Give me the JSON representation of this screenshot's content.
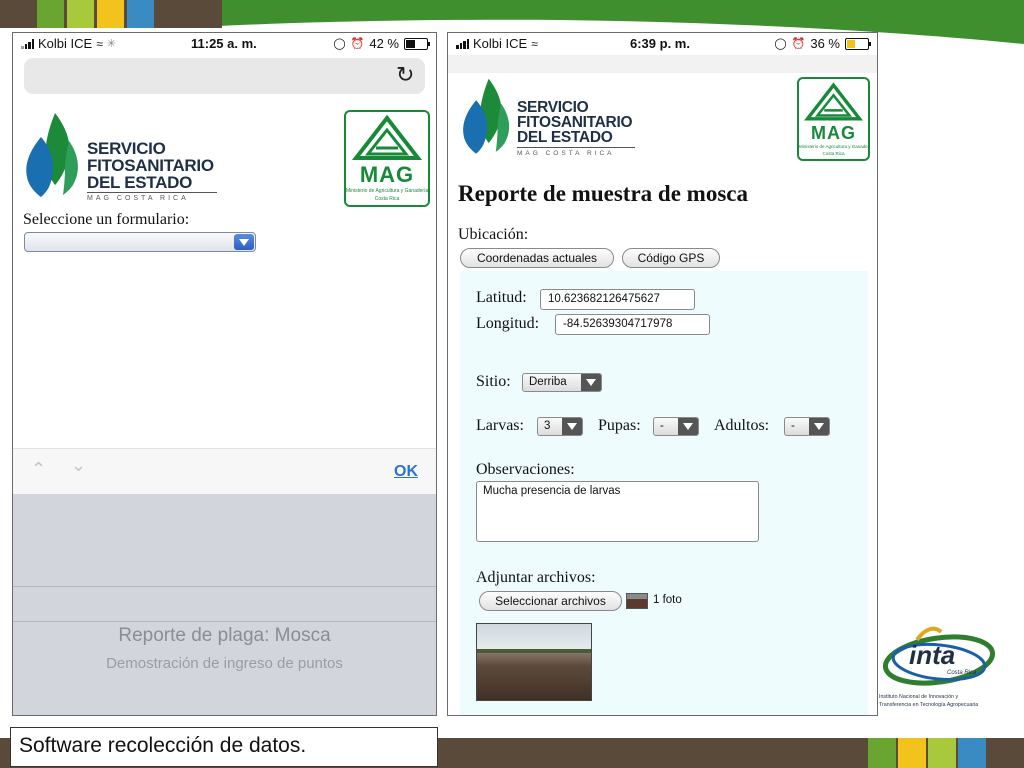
{
  "slide": {
    "caption": "Software recolección de datos.",
    "colors": {
      "frame_green": "#3f8f2f",
      "frame_brown": "#5a4a3a",
      "stripe_colors": [
        "#6aa531",
        "#a9c93c",
        "#f2c21d",
        "#3a8bc2"
      ]
    }
  },
  "phone_left": {
    "status": {
      "carrier": "Kolbi ICE",
      "time": "11:25 a. m.",
      "battery": "42 %"
    },
    "logo_sfe": {
      "lines": [
        "SERVICIO",
        "FITOSANITARIO",
        "DEL ESTADO"
      ],
      "sub": "MAG COSTA RICA"
    },
    "logo_mag": {
      "word": "MAG",
      "small": "Ministerio de Agricultura y Ganadería",
      "small2": "Costa Rica"
    },
    "form_label": "Seleccione un formulario:",
    "keyboard": {
      "done": "OK"
    },
    "picker": {
      "option1": "Reporte de plaga: Mosca",
      "option2": "Demostración de ingreso de puntos"
    }
  },
  "phone_right": {
    "status": {
      "carrier": "Kolbi ICE",
      "time": "6:39 p. m.",
      "battery": "36 %"
    },
    "logo_sfe": {
      "lines": [
        "SERVICIO",
        "FITOSANITARIO",
        "DEL ESTADO"
      ],
      "sub": "MAG COSTA RICA"
    },
    "logo_mag": {
      "word": "MAG",
      "small": "Ministerio de Agricultura y Ganadería",
      "small2": "Costa Rica"
    },
    "title": "Reporte de muestra de mosca",
    "ubicacion_label": "Ubicación:",
    "btn_coords": "Coordenadas actuales",
    "btn_gps": "Código GPS",
    "lat_label": "Latitud:",
    "lat_value": "10.623682126475627",
    "lon_label": "Longitud:",
    "lon_value": "-84.52639304717978",
    "sitio_label": "Sitio:",
    "sitio_value": "Derriba",
    "larvas_label": "Larvas:",
    "larvas_value": "3",
    "pupas_label": "Pupas:",
    "pupas_value": "-",
    "adultos_label": "Adultos:",
    "adultos_value": "-",
    "obs_label": "Observaciones:",
    "obs_value": "Mucha presencia de larvas",
    "adjuntar_label": "Adjuntar archivos:",
    "btn_select": "Seleccionar archivos",
    "file_count": "1 foto"
  },
  "inta_logo": {
    "word": "inta",
    "sub": "Costa Rica",
    "line1": "Instituto Nacional de Innovación y",
    "line2": "Transferencia en Tecnología Agropecuaria"
  }
}
